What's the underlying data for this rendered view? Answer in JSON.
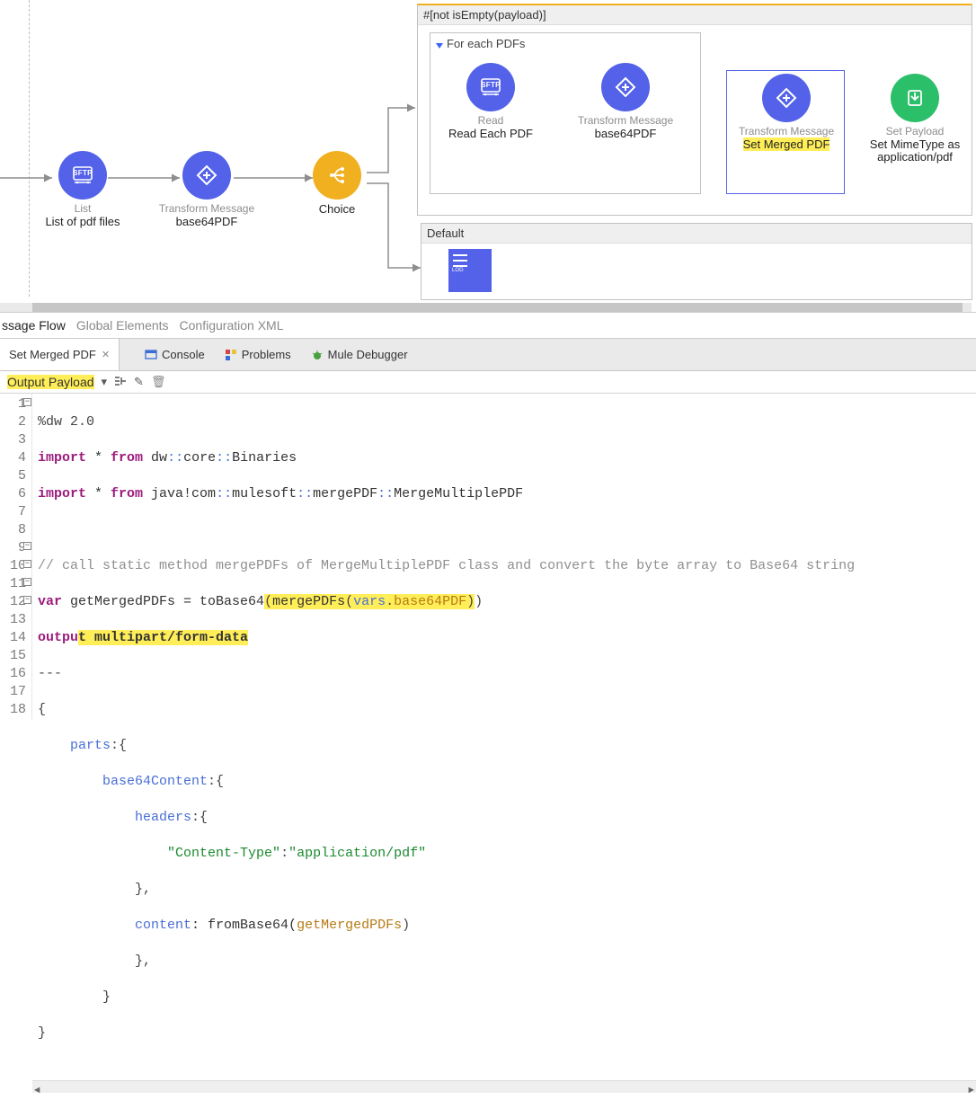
{
  "flow": {
    "list": {
      "type": "List",
      "name": "List of pdf files"
    },
    "tx1": {
      "type": "Transform Message",
      "name": "base64PDF"
    },
    "choice": {
      "type": "",
      "name": "Choice"
    },
    "routeHeader": "#[not isEmpty(payload)]",
    "foreach": "For each PDFs",
    "read": {
      "type": "Read",
      "name": "Read Each PDF"
    },
    "tx2": {
      "type": "Transform Message",
      "name": "base64PDF"
    },
    "tx3": {
      "type": "Transform Message",
      "name": "Set Merged PDF"
    },
    "setpl": {
      "type": "Set Payload",
      "name": "Set MimeType as application/pdf"
    },
    "defaultHdr": "Default"
  },
  "miniTabs": {
    "active": "ssage Flow",
    "t2": "Global Elements",
    "t3": "Configuration XML"
  },
  "editorHeader": {
    "tab": "Set Merged PDF",
    "views": {
      "console": "Console",
      "problems": "Problems",
      "debugger": "Mule Debugger"
    }
  },
  "outputBar": {
    "label": "Output  Payload"
  },
  "code": {
    "lines": {
      "l1a": "%dw 2.0",
      "l2a": "import",
      "l2b": " * ",
      "l2c": "from",
      "l2d": " dw",
      "l2e": "::",
      "l2f": "core",
      "l2g": "::",
      "l2h": "Binaries",
      "l3a": "import",
      "l3b": " * ",
      "l3c": "from",
      "l3d": " java!com",
      "l3e": "::",
      "l3f": "mulesoft",
      "l3g": "::",
      "l3h": "mergePDF",
      "l3i": "::",
      "l3j": "MergeMultiplePDF",
      "l5": "// call static method mergePDFs of MergeMultiplePDF class and convert the byte array to Base64 string",
      "l6a": "var",
      "l6b": " getMergedPDFs = toBase64",
      "l6c": "(",
      "l6d": "mergePDFs",
      "l6e": "(",
      "l6f": "vars",
      "l6g": ".",
      "l6h": "base64PDF",
      "l6i": ")",
      "l6j": ")",
      "l7a": "outpu",
      "l7b": "t multipart/form-data",
      "l8": "---",
      "l9": "{",
      "l10a": "    parts",
      "l10b": ":{",
      "l11a": "        base64Content",
      "l11b": ":{",
      "l12a": "            headers",
      "l12b": ":{",
      "l13a": "                ",
      "l13b": "\"Content-Type\"",
      "l13c": ":",
      "l13d": "\"application/pdf\"",
      "l14": "            },",
      "l15a": "            content",
      "l15b": ": fromBase64(",
      "l15c": "getMergedPDFs",
      "l15d": ")",
      "l16": "            },",
      "l17": "        }",
      "l18": "}"
    }
  }
}
